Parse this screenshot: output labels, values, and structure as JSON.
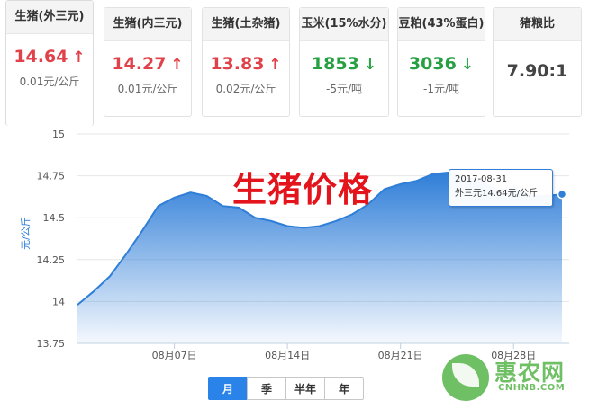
{
  "cards": [
    {
      "title": "生猪(外三元)",
      "price": "14.64",
      "trend": "up",
      "change": "0.01元/公斤",
      "active": true
    },
    {
      "title": "生猪(内三元)",
      "price": "14.27",
      "trend": "up",
      "change": "0.01元/公斤"
    },
    {
      "title": "生猪(土杂猪)",
      "price": "13.83",
      "trend": "up",
      "change": "0.02元/公斤"
    },
    {
      "title": "玉米(15%水分)",
      "price": "1853",
      "trend": "down",
      "change": "-5元/吨"
    },
    {
      "title": "豆粕(43%蛋白)",
      "price": "3036",
      "trend": "down",
      "change": "-1元/吨"
    },
    {
      "title": "猪粮比",
      "price": "7.90:1",
      "trend": "flat",
      "change": ""
    }
  ],
  "overlay_title": "生猪价格",
  "tooltip": {
    "date": "2017-08-31",
    "text": "外三元14.64元/公斤"
  },
  "range_buttons": [
    {
      "label": "月",
      "active": true
    },
    {
      "label": "季"
    },
    {
      "label": "半年"
    },
    {
      "label": "年"
    }
  ],
  "logo": {
    "name": "惠农网",
    "domain": "CNHNB.COM"
  },
  "colors": {
    "up": "#e1424a",
    "down": "#27a043",
    "line": "#2f7ed8",
    "active_button": "#2a83e8",
    "logo": "#56b44a"
  },
  "chart_data": {
    "type": "area",
    "ylabel": "元/公斤",
    "ylim": [
      13.75,
      15
    ],
    "yticks": [
      "13.75",
      "14",
      "14.25",
      "14.5",
      "14.75",
      "15"
    ],
    "xticks": [
      {
        "label": "08月07日",
        "x": 7
      },
      {
        "label": "08月14日",
        "x": 14
      },
      {
        "label": "08月21日",
        "x": 21
      },
      {
        "label": "08月28日",
        "x": 28
      }
    ],
    "xlim": [
      1,
      31
    ],
    "series": [
      {
        "points": [
          [
            1,
            13.98
          ],
          [
            2,
            14.06
          ],
          [
            3,
            14.15
          ],
          [
            4,
            14.28
          ],
          [
            5,
            14.42
          ],
          [
            6,
            14.57
          ],
          [
            7,
            14.62
          ],
          [
            8,
            14.65
          ],
          [
            9,
            14.63
          ],
          [
            10,
            14.57
          ],
          [
            11,
            14.56
          ],
          [
            12,
            14.5
          ],
          [
            13,
            14.48
          ],
          [
            14,
            14.45
          ],
          [
            15,
            14.44
          ],
          [
            16,
            14.45
          ],
          [
            17,
            14.48
          ],
          [
            18,
            14.52
          ],
          [
            19,
            14.58
          ],
          [
            20,
            14.67
          ],
          [
            21,
            14.7
          ],
          [
            22,
            14.72
          ],
          [
            23,
            14.76
          ],
          [
            24,
            14.77
          ],
          [
            25,
            14.74
          ],
          [
            26,
            14.72
          ],
          [
            27,
            14.66
          ],
          [
            28,
            14.68
          ],
          [
            29,
            14.63
          ],
          [
            30,
            14.63
          ],
          [
            31,
            14.64
          ]
        ]
      }
    ],
    "highlight": {
      "x": 31,
      "y": 14.64
    },
    "grid": true
  }
}
